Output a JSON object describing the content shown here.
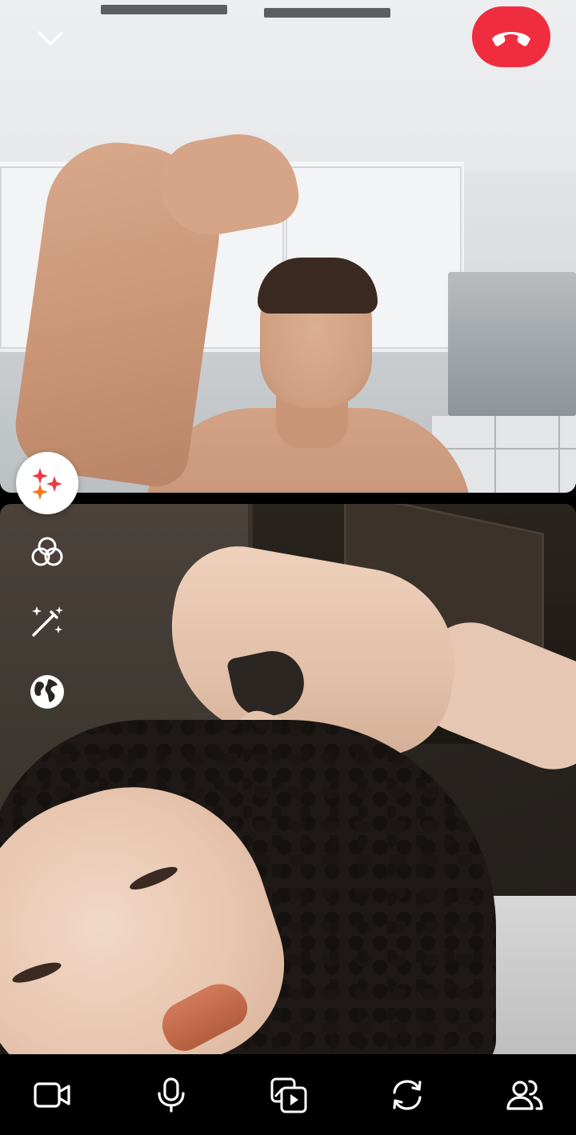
{
  "colors": {
    "end_call": "#ef2d3f",
    "icon_white": "#ffffff",
    "bar_background": "#000000",
    "sparkle_red": "#ee3a45",
    "sparkle_orange": "#f27a1a"
  },
  "top_controls": {
    "collapse_icon": "chevron-down-icon",
    "end_call_icon": "phone-hangup-icon"
  },
  "effects_rail": {
    "items": [
      {
        "icon": "sparkles-icon",
        "active": true
      },
      {
        "icon": "filters-icon",
        "active": false
      },
      {
        "icon": "magic-wand-icon",
        "active": false
      },
      {
        "icon": "globe-icon",
        "active": false
      }
    ]
  },
  "bottom_bar": {
    "items": [
      {
        "icon": "video-camera-icon"
      },
      {
        "icon": "microphone-icon"
      },
      {
        "icon": "share-media-icon"
      },
      {
        "icon": "flip-camera-icon"
      },
      {
        "icon": "participants-icon"
      }
    ]
  }
}
